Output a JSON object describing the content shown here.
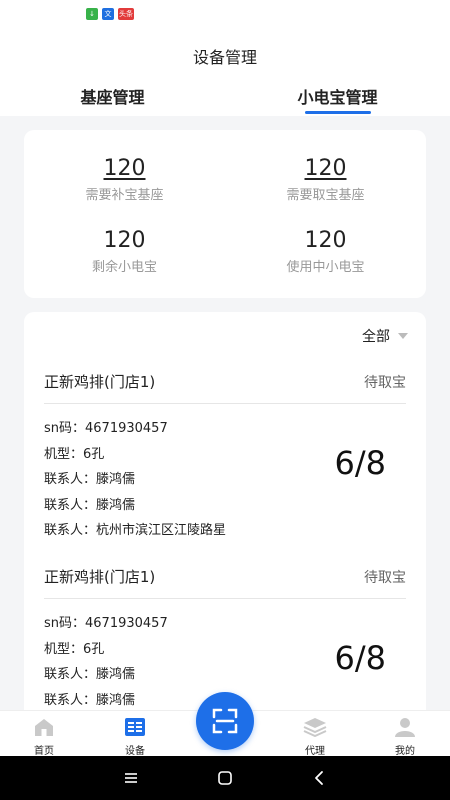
{
  "status_bar": {
    "icon_a": "↓",
    "icon_b": "文",
    "icon_c": "头条"
  },
  "header": {
    "title": "设备管理",
    "tabs": [
      {
        "label": "基座管理",
        "active": false
      },
      {
        "label": "小电宝管理",
        "active": true
      }
    ]
  },
  "stats": [
    {
      "value": "120",
      "label": "需要补宝基座"
    },
    {
      "value": "120",
      "label": "需要取宝基座"
    },
    {
      "value": "120",
      "label": "剩余小电宝"
    },
    {
      "value": "120",
      "label": "使用中小电宝"
    }
  ],
  "filter": {
    "label": "全部"
  },
  "devices": [
    {
      "store": "正新鸡排(门店1)",
      "status": "待取宝",
      "sn": "sn码：4671930457",
      "model": "机型：6孔",
      "contact1": "联系人：滕鸿儒",
      "contact2": "联系人：滕鸿儒",
      "contact3": "联系人：杭州市滨江区江陵路星",
      "ratio": "6/8"
    },
    {
      "store": "正新鸡排(门店1)",
      "status": "待取宝",
      "sn": "sn码：4671930457",
      "model": "机型：6孔",
      "contact1": "联系人：滕鸿儒",
      "contact2": "联系人：滕鸿儒",
      "ratio": "6/8"
    }
  ],
  "nav": [
    {
      "label": "首页",
      "icon": "home-icon"
    },
    {
      "label": "设备",
      "icon": "device-list-icon"
    },
    {
      "label": "代理",
      "icon": "layers-icon"
    },
    {
      "label": "我的",
      "icon": "user-icon"
    }
  ],
  "colors": {
    "accent": "#1e6fe8",
    "muted": "#999999",
    "background": "#f4f5f7"
  }
}
